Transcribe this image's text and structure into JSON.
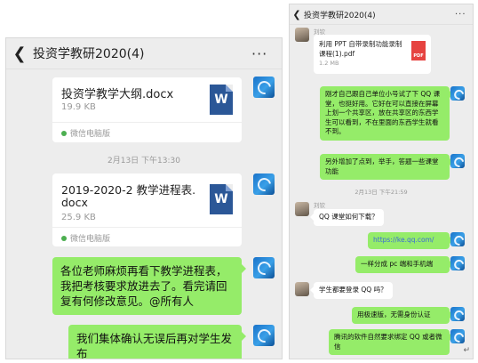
{
  "left": {
    "title": "投资学教研2020(4)",
    "file1": {
      "name": "投资学教学大纲.docx",
      "size": "19.9 KB",
      "source": "微信电脑版",
      "icon": "W"
    },
    "time1": "2月13日 下午13:30",
    "file2": {
      "name_line1": "2019-2020-2 教学进程表.",
      "name_line2": "docx",
      "size": "25.9 KB",
      "source": "微信电脑版",
      "icon": "W"
    },
    "msg1": "各位老师麻烦再看下教学进程表，我把考核要求放进去了。看完请回复有何修改意见。@所有人",
    "msg2": "我们集体确认无误后再对学生发布"
  },
  "right": {
    "title": "投资学教研2020(4)",
    "sender_top": "刘钦",
    "file": {
      "name_line1": "利用 PPT 自带录制功能录制",
      "name_line2": "课程(1).pdf",
      "size": "1.2 MB",
      "icon": "PDF"
    },
    "msg1": "刚才自己跟自己单位小号试了下 QQ 课堂，也挺好用。它好在可以直接在屏幕上划一个共享区，放在共享区的东西学生可以看到，不在里面的东西学生就看不到。",
    "msg2": "另外增加了点到，举手，答题一些课堂功能",
    "time": "2月13日 下午21:59",
    "sender_mid": "刘钦",
    "msg3": "QQ 课堂如何下载？",
    "msg4": "https://ke.qq.com/",
    "msg5": "一样分成 pc 端和手机端",
    "msg6": "学生都要登录 QQ 吗？",
    "msg7": "用极速版，无需身份认证",
    "msg8": "腾讯的软件自然要求绑定 QQ 或者微信",
    "return_mark": "↵"
  }
}
